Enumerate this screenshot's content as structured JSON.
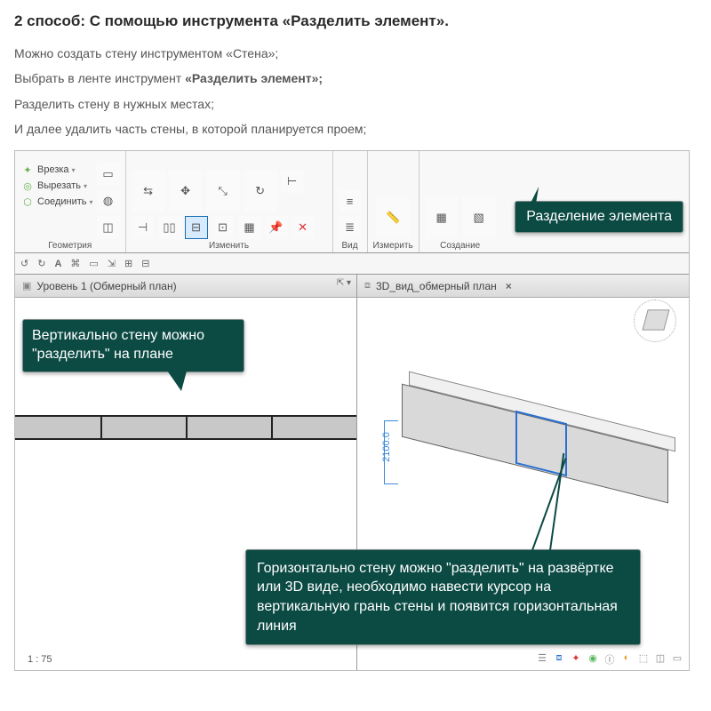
{
  "heading": "2 способ: С помощью инструмента «Разделить элемент».",
  "intro": {
    "p1": "Можно создать стену инструментом «Стена»;",
    "p2_pre": "Выбрать в ленте инструмент ",
    "p2_bold": "«Разделить элемент»;",
    "p3": "Разделить стену в нужных местах;",
    "p4": "И далее удалить часть стены, в которой планируется проем;"
  },
  "ribbon": {
    "groups": {
      "geom_lbl": "Геометрия",
      "modify_lbl": "Изменить",
      "view_lbl": "Вид",
      "measure_lbl": "Измерить",
      "create_lbl": "Создание"
    },
    "geom_rows": {
      "r1": "Врезка",
      "r2": "Вырезать",
      "r3": "Соединить"
    },
    "tooltip": "Разделение элемента"
  },
  "tabs": {
    "left": "Уровень 1 (Обмерный план)",
    "right": "3D_вид_обмерный план"
  },
  "callout_plan": "Вертикально стену можно \"разделить\" на плане",
  "callout_3d": "Горизонтально стену можно \"разделить\" на развёртке или 3D виде, необходимо навести курсор на вертикальную грань стены и появится горизонтальная линия",
  "left_scale": "1 : 75",
  "dim_value": "2100.0"
}
